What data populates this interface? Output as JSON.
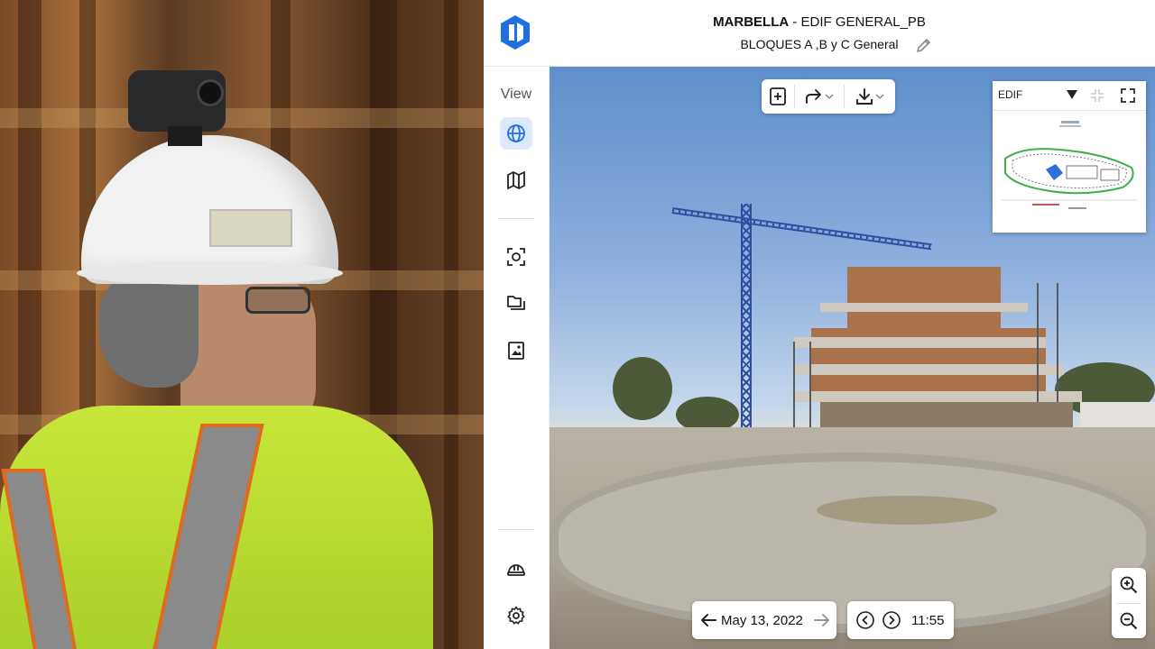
{
  "header": {
    "title_bold": "MARBELLA",
    "title_rest": " - EDIF GENERAL_PB",
    "subtitle": "BLOQUES A ,B y C General"
  },
  "sidebar": {
    "view_label": "View",
    "items": [
      {
        "icon": "globe-icon",
        "active": true
      },
      {
        "icon": "map-icon",
        "active": false
      },
      {
        "icon": "capture-icon",
        "active": false
      },
      {
        "icon": "folders-icon",
        "active": false
      },
      {
        "icon": "image-report-icon",
        "active": false
      },
      {
        "icon": "hardhat-icon",
        "active": false
      },
      {
        "icon": "gear-icon",
        "active": false
      }
    ]
  },
  "minimap": {
    "level_select": "EDIF"
  },
  "timeline": {
    "date": "May 13, 2022",
    "time": "11:55"
  },
  "colors": {
    "brand_blue": "#1f6fe0",
    "active_bg": "#dce9fb"
  }
}
